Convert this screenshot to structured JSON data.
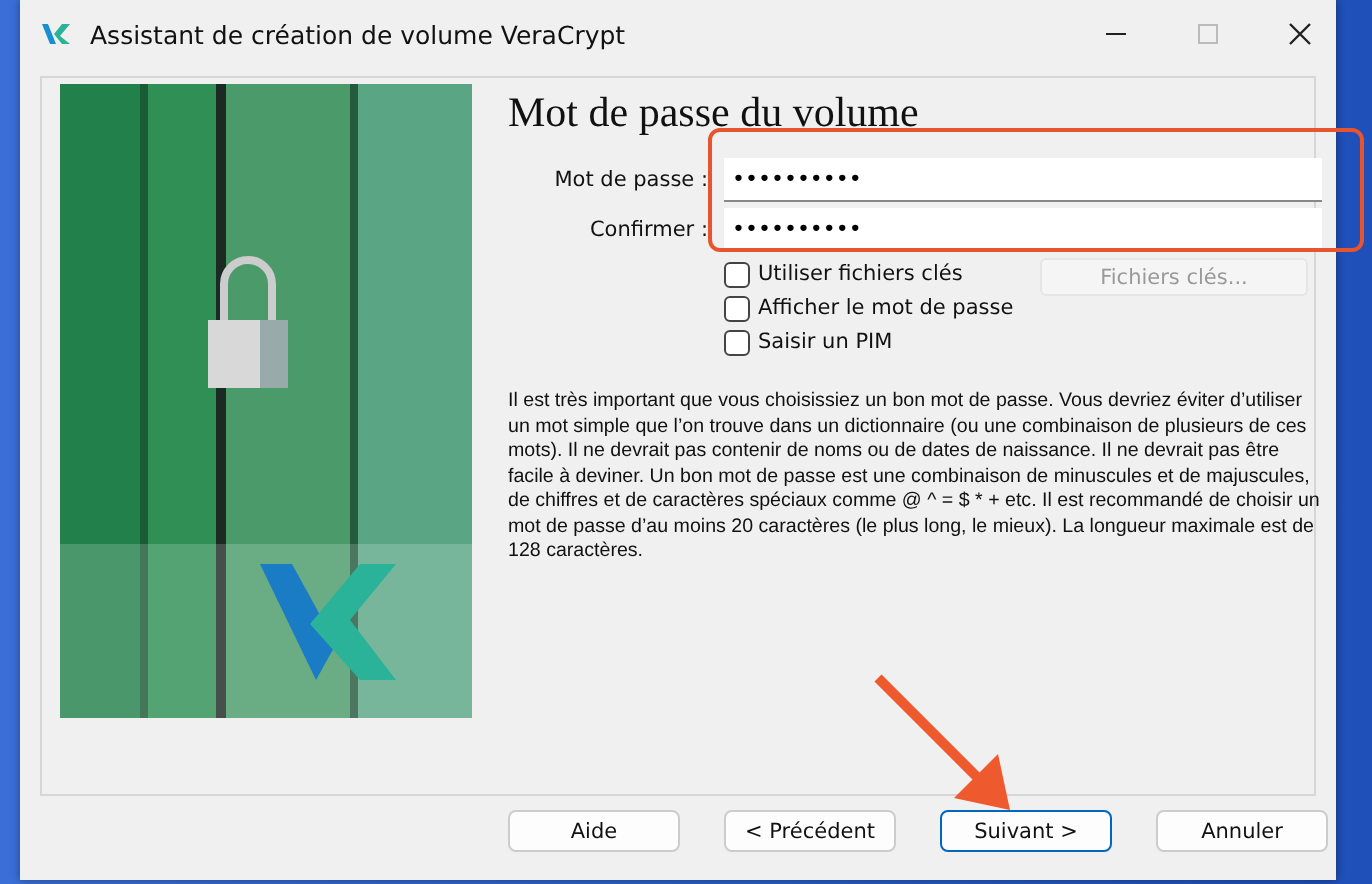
{
  "window": {
    "title": "Assistant de création de volume VeraCrypt"
  },
  "heading": "Mot de passe du volume",
  "fields": [
    {
      "label": "Mot de passe :",
      "value": "••••••••••"
    },
    {
      "label": "Confirmer :",
      "value": "••••••••••"
    }
  ],
  "checkboxes": [
    {
      "label": "Utiliser fichiers clés",
      "checked": false
    },
    {
      "label": "Afficher le mot de passe",
      "checked": false
    },
    {
      "label": "Saisir un PIM",
      "checked": false
    }
  ],
  "keyfiles_button": {
    "label": "Fichiers clés...",
    "disabled": true
  },
  "description": "Il est très important que vous choisissiez un bon mot de passe. Vous devriez éviter d’utiliser un mot simple que l’on trouve dans un dictionnaire (ou une combinaison de plusieurs de ces mots). Il ne devrait pas contenir de noms ou de dates de naissance. Il ne devrait pas être facile à deviner. Un bon mot de passe est une combinaison de minuscules et de majuscules, de chiffres et de caractères spéciaux comme @ ^ = $ * + etc. Il est recommandé de choisir un mot de passe d’au moins 20 caractères (le plus long, le mieux). La longueur maximale est de 128 caractères.",
  "buttons": [
    {
      "label": "Aide",
      "default": false
    },
    {
      "label": "< Précédent",
      "default": false
    },
    {
      "label": "Suivant >",
      "default": true
    },
    {
      "label": "Annuler",
      "default": false
    }
  ]
}
